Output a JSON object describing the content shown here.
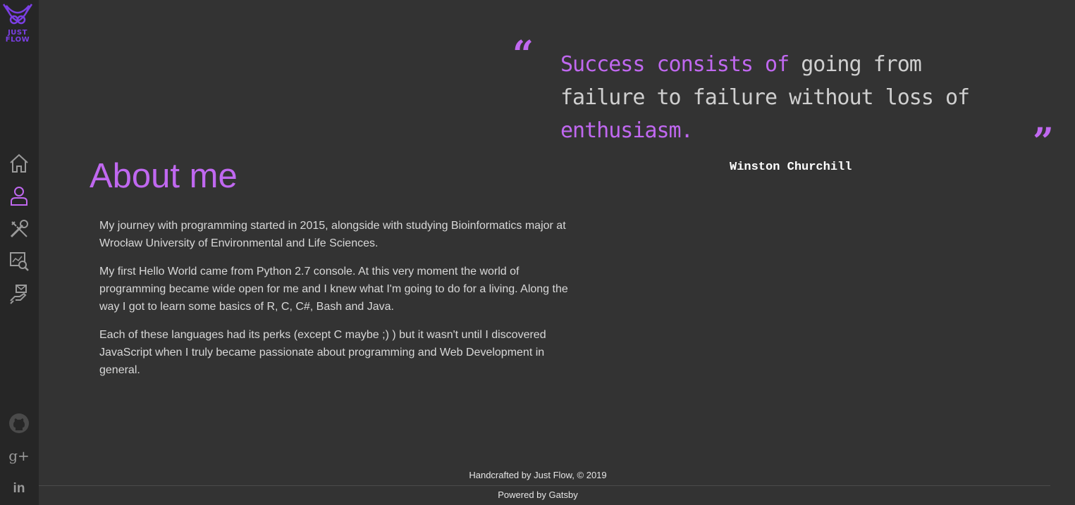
{
  "brand": {
    "logo_line1": "JUST",
    "logo_line2": "FLOW",
    "accent_color": "#c068f0",
    "logo_color": "#7b3fe4"
  },
  "nav": {
    "items": [
      {
        "name": "home",
        "icon": "home-icon",
        "active": false
      },
      {
        "name": "about",
        "icon": "user-icon",
        "active": true
      },
      {
        "name": "skills",
        "icon": "tools-icon",
        "active": false
      },
      {
        "name": "projects",
        "icon": "search-chart-icon",
        "active": false
      },
      {
        "name": "contact",
        "icon": "mail-hand-icon",
        "active": false
      }
    ]
  },
  "social": [
    {
      "name": "github",
      "icon": "github-icon"
    },
    {
      "name": "google-plus",
      "icon": "google-plus-icon",
      "label": "g+"
    },
    {
      "name": "linkedin",
      "icon": "linkedin-icon",
      "label": "in"
    }
  ],
  "about": {
    "title": "About me",
    "paragraphs": [
      "My journey with programming started in 2015, alongside with studying Bioinformatics major at Wrocław University of Environmental and Life Sciences.",
      "My first Hello World came from Python 2.7 console. At this very moment the world of programming became wide open for me and I knew what I'm going to do for a living. Along the way I got to learn some basics of R, C, C#, Bash and Java.",
      "Each of these languages had its perks (except C maybe ;) ) but it wasn't until I discovered JavaScript when I truly became passionate about programming and Web Development in general."
    ]
  },
  "quote": {
    "open_mark": "“",
    "close_mark": "”",
    "part1_accent": "Success consists of",
    "part2": " going from failure to failure without loss of ",
    "part3_accent": "enthusiasm.",
    "author": "Winston Churchill"
  },
  "footer": {
    "credit": "Handcrafted by Just Flow, © 2019",
    "powered": "Powered by Gatsby"
  }
}
